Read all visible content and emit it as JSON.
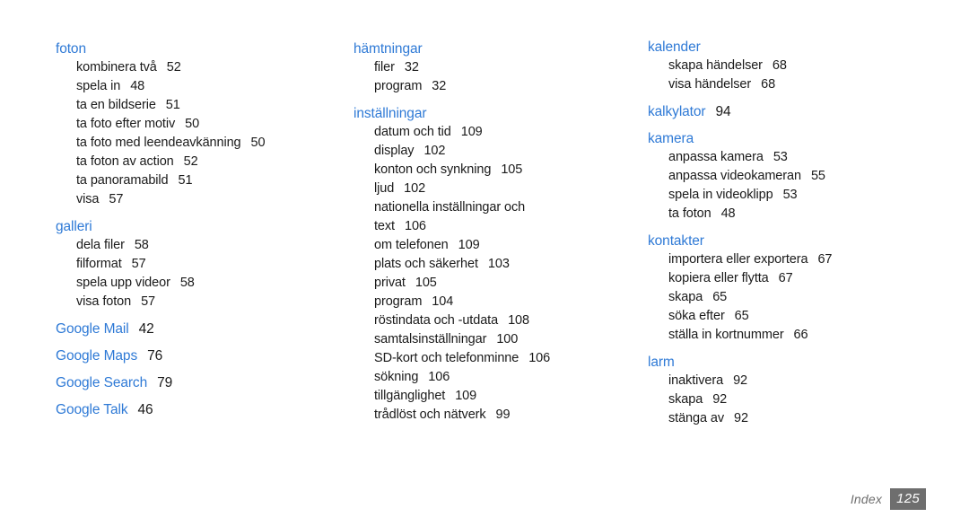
{
  "document": {
    "title": "Index",
    "language": "sv",
    "page_number": "125",
    "colors": {
      "heading": "#2f7ad6",
      "body": "#1a1a1a",
      "footer": "#6e6e6e",
      "background": "#ffffff"
    }
  },
  "footer": {
    "label": "Index",
    "page": "125"
  },
  "columns": [
    {
      "groups": [
        {
          "heading": "foton",
          "page": "",
          "entries": [
            {
              "label": "kombinera två",
              "page": "52"
            },
            {
              "label": "spela in",
              "page": "48"
            },
            {
              "label": "ta en bildserie",
              "page": "51"
            },
            {
              "label": "ta foto efter motiv",
              "page": "50"
            },
            {
              "label": "ta foto med leendeavkänning",
              "page": "50"
            },
            {
              "label": "ta foton av action",
              "page": "52"
            },
            {
              "label": "ta panoramabild",
              "page": "51"
            },
            {
              "label": "visa",
              "page": "57"
            }
          ]
        },
        {
          "heading": "galleri",
          "page": "",
          "entries": [
            {
              "label": "dela filer",
              "page": "58"
            },
            {
              "label": "filformat",
              "page": "57"
            },
            {
              "label": "spela upp videor",
              "page": "58"
            },
            {
              "label": "visa foton",
              "page": "57"
            }
          ]
        },
        {
          "heading": "Google Mail",
          "page": "42",
          "entries": []
        },
        {
          "heading": "Google Maps",
          "page": "76",
          "entries": []
        },
        {
          "heading": "Google Search",
          "page": "79",
          "entries": []
        },
        {
          "heading": "Google Talk",
          "page": "46",
          "entries": []
        }
      ]
    },
    {
      "groups": [
        {
          "heading": "hämtningar",
          "page": "",
          "entries": [
            {
              "label": "filer",
              "page": "32"
            },
            {
              "label": "program",
              "page": "32"
            }
          ]
        },
        {
          "heading": "inställningar",
          "page": "",
          "entries": [
            {
              "label": "datum och tid",
              "page": "109"
            },
            {
              "label": "display",
              "page": "102"
            },
            {
              "label": "konton och synkning",
              "page": "105"
            },
            {
              "label": "ljud",
              "page": "102"
            },
            {
              "label": "nationella inställningar och",
              "continuation": "text",
              "page": "106"
            },
            {
              "label": "om telefonen",
              "page": "109"
            },
            {
              "label": "plats och säkerhet",
              "page": "103"
            },
            {
              "label": "privat",
              "page": "105"
            },
            {
              "label": "program",
              "page": "104"
            },
            {
              "label": "röstindata och -utdata",
              "page": "108"
            },
            {
              "label": "samtalsinställningar",
              "page": "100"
            },
            {
              "label": "SD-kort och telefonminne",
              "page": "106"
            },
            {
              "label": "sökning",
              "page": "106"
            },
            {
              "label": "tillgänglighet",
              "page": "109"
            },
            {
              "label": "trådlöst och nätverk",
              "page": "99"
            }
          ]
        }
      ]
    },
    {
      "groups": [
        {
          "heading": "kalender",
          "page": "",
          "entries": [
            {
              "label": "skapa händelser",
              "page": "68"
            },
            {
              "label": "visa händelser",
              "page": "68"
            }
          ]
        },
        {
          "heading": "kalkylator",
          "page": "94",
          "entries": []
        },
        {
          "heading": "kamera",
          "page": "",
          "entries": [
            {
              "label": "anpassa kamera",
              "page": "53"
            },
            {
              "label": "anpassa videokameran",
              "page": "55"
            },
            {
              "label": "spela in videoklipp",
              "page": "53"
            },
            {
              "label": "ta foton",
              "page": "48"
            }
          ]
        },
        {
          "heading": "kontakter",
          "page": "",
          "entries": [
            {
              "label": "importera eller exportera",
              "page": "67"
            },
            {
              "label": "kopiera eller flytta",
              "page": "67"
            },
            {
              "label": "skapa",
              "page": "65"
            },
            {
              "label": "söka efter",
              "page": "65"
            },
            {
              "label": "ställa in kortnummer",
              "page": "66"
            }
          ]
        },
        {
          "heading": "larm",
          "page": "",
          "entries": [
            {
              "label": "inaktivera",
              "page": "92"
            },
            {
              "label": "skapa",
              "page": "92"
            },
            {
              "label": "stänga av",
              "page": "92"
            }
          ]
        }
      ]
    }
  ]
}
